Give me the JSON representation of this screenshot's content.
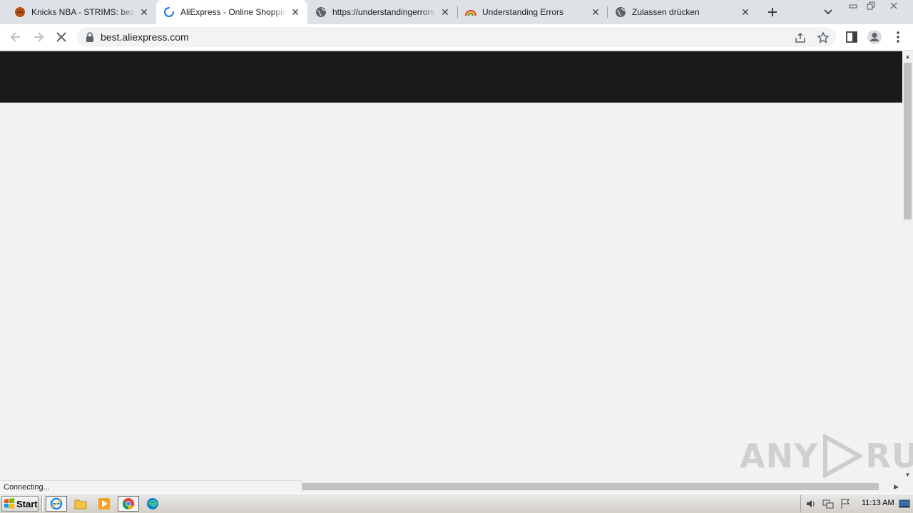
{
  "tabs": [
    {
      "title": "Knicks NBA - STRIMS: bezpłatn",
      "icon": "basketball-icon",
      "active": false
    },
    {
      "title": "AliExpress - Online Shopping fo",
      "icon": "loading-spinner-icon",
      "active": true
    },
    {
      "title": "https://understandingerrors.c",
      "icon": "globe-icon",
      "active": false
    },
    {
      "title": "Understanding Errors",
      "icon": "rainbow-icon",
      "active": false
    },
    {
      "title": "Zulassen drücken",
      "icon": "globe-icon",
      "active": false
    }
  ],
  "toolbar": {
    "url": "best.aliexpress.com"
  },
  "status": {
    "text": "Connecting..."
  },
  "watermark": {
    "left": "ANY",
    "right": "RUN"
  },
  "taskbar": {
    "start_label": "Start",
    "clock": "11:13 AM"
  },
  "colors": {
    "page_header": "#1a1a1a",
    "page_bg": "#f2f2f2",
    "tabstrip_bg": "#dee1e6"
  }
}
